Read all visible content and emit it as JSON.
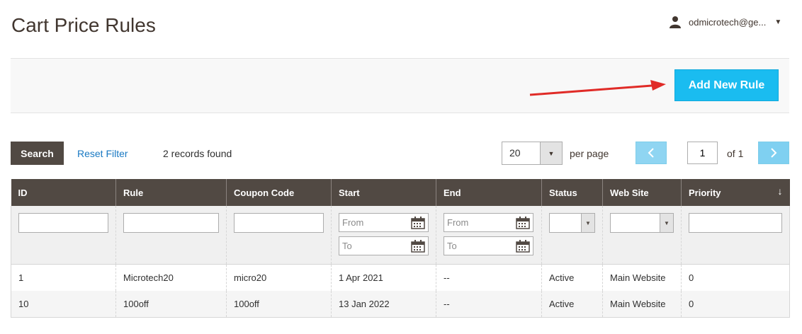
{
  "header": {
    "title": "Cart Price Rules",
    "user": "odmicrotech@ge..."
  },
  "actions": {
    "add_label": "Add New Rule"
  },
  "toolbar": {
    "search_label": "Search",
    "reset_label": "Reset Filter",
    "records": "2 records found",
    "per_page_value": "20",
    "per_page_label": "per page",
    "page": "1",
    "of_label": "of 1"
  },
  "columns": [
    "ID",
    "Rule",
    "Coupon Code",
    "Start",
    "End",
    "Status",
    "Web Site",
    "Priority"
  ],
  "filters": {
    "from_placeholder": "From",
    "to_placeholder": "To"
  },
  "rows": [
    {
      "id": "1",
      "rule": "Microtech20",
      "coupon": "micro20",
      "start": "1 Apr 2021",
      "end": "--",
      "status": "Active",
      "website": "Main Website",
      "priority": "0"
    },
    {
      "id": "10",
      "rule": "100off",
      "coupon": "100off",
      "start": "13 Jan 2022",
      "end": "--",
      "status": "Active",
      "website": "Main Website",
      "priority": "0"
    }
  ],
  "colors": {
    "header_bg": "#514943",
    "accent": "#1abcf0",
    "link": "#1979c3",
    "arrow": "#e02b27"
  }
}
